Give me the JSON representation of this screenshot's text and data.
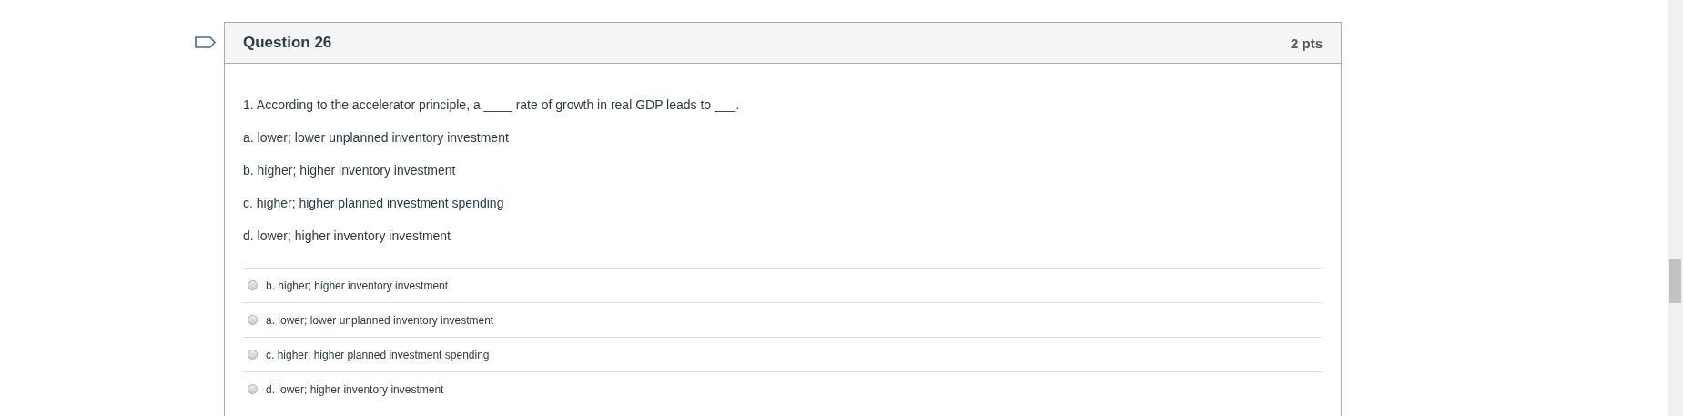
{
  "question": {
    "title": "Question 26",
    "points": "2 pts",
    "prompt": "1. According to the accelerator principle, a ____ rate of growth in real GDP leads to ___.",
    "choices": [
      "a. lower; lower unplanned inventory investment",
      "b. higher; higher inventory investment",
      "c. higher; higher planned investment spending",
      "d. lower; higher inventory investment"
    ],
    "answers": [
      {
        "label": "b. higher; higher inventory investment",
        "selected": false
      },
      {
        "label": "a. lower; lower unplanned inventory investment",
        "selected": false
      },
      {
        "label": "c. higher; higher planned investment spending",
        "selected": false
      },
      {
        "label": "d. lower; higher inventory investment",
        "selected": false
      }
    ]
  }
}
